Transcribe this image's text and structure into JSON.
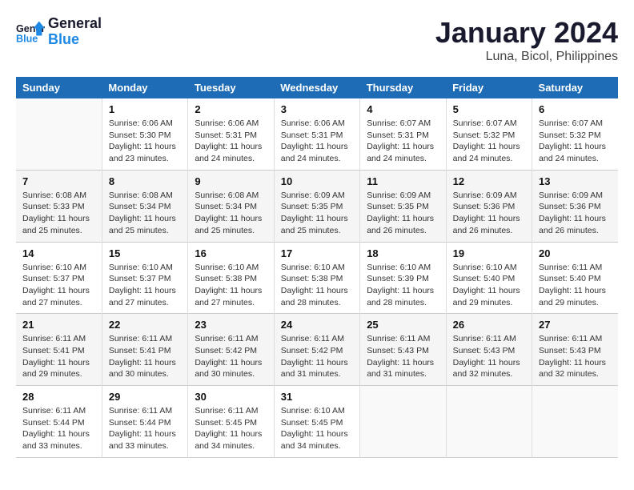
{
  "header": {
    "logo_general": "General",
    "logo_blue": "Blue",
    "title": "January 2024",
    "subtitle": "Luna, Bicol, Philippines"
  },
  "weekdays": [
    "Sunday",
    "Monday",
    "Tuesday",
    "Wednesday",
    "Thursday",
    "Friday",
    "Saturday"
  ],
  "weeks": [
    [
      {
        "day": "",
        "sunrise": "",
        "sunset": "",
        "daylight": ""
      },
      {
        "day": "1",
        "sunrise": "Sunrise: 6:06 AM",
        "sunset": "Sunset: 5:30 PM",
        "daylight": "Daylight: 11 hours and 23 minutes."
      },
      {
        "day": "2",
        "sunrise": "Sunrise: 6:06 AM",
        "sunset": "Sunset: 5:31 PM",
        "daylight": "Daylight: 11 hours and 24 minutes."
      },
      {
        "day": "3",
        "sunrise": "Sunrise: 6:06 AM",
        "sunset": "Sunset: 5:31 PM",
        "daylight": "Daylight: 11 hours and 24 minutes."
      },
      {
        "day": "4",
        "sunrise": "Sunrise: 6:07 AM",
        "sunset": "Sunset: 5:31 PM",
        "daylight": "Daylight: 11 hours and 24 minutes."
      },
      {
        "day": "5",
        "sunrise": "Sunrise: 6:07 AM",
        "sunset": "Sunset: 5:32 PM",
        "daylight": "Daylight: 11 hours and 24 minutes."
      },
      {
        "day": "6",
        "sunrise": "Sunrise: 6:07 AM",
        "sunset": "Sunset: 5:32 PM",
        "daylight": "Daylight: 11 hours and 24 minutes."
      }
    ],
    [
      {
        "day": "7",
        "sunrise": "Sunrise: 6:08 AM",
        "sunset": "Sunset: 5:33 PM",
        "daylight": "Daylight: 11 hours and 25 minutes."
      },
      {
        "day": "8",
        "sunrise": "Sunrise: 6:08 AM",
        "sunset": "Sunset: 5:34 PM",
        "daylight": "Daylight: 11 hours and 25 minutes."
      },
      {
        "day": "9",
        "sunrise": "Sunrise: 6:08 AM",
        "sunset": "Sunset: 5:34 PM",
        "daylight": "Daylight: 11 hours and 25 minutes."
      },
      {
        "day": "10",
        "sunrise": "Sunrise: 6:09 AM",
        "sunset": "Sunset: 5:35 PM",
        "daylight": "Daylight: 11 hours and 25 minutes."
      },
      {
        "day": "11",
        "sunrise": "Sunrise: 6:09 AM",
        "sunset": "Sunset: 5:35 PM",
        "daylight": "Daylight: 11 hours and 26 minutes."
      },
      {
        "day": "12",
        "sunrise": "Sunrise: 6:09 AM",
        "sunset": "Sunset: 5:36 PM",
        "daylight": "Daylight: 11 hours and 26 minutes."
      },
      {
        "day": "13",
        "sunrise": "Sunrise: 6:09 AM",
        "sunset": "Sunset: 5:36 PM",
        "daylight": "Daylight: 11 hours and 26 minutes."
      }
    ],
    [
      {
        "day": "14",
        "sunrise": "Sunrise: 6:10 AM",
        "sunset": "Sunset: 5:37 PM",
        "daylight": "Daylight: 11 hours and 27 minutes."
      },
      {
        "day": "15",
        "sunrise": "Sunrise: 6:10 AM",
        "sunset": "Sunset: 5:37 PM",
        "daylight": "Daylight: 11 hours and 27 minutes."
      },
      {
        "day": "16",
        "sunrise": "Sunrise: 6:10 AM",
        "sunset": "Sunset: 5:38 PM",
        "daylight": "Daylight: 11 hours and 27 minutes."
      },
      {
        "day": "17",
        "sunrise": "Sunrise: 6:10 AM",
        "sunset": "Sunset: 5:38 PM",
        "daylight": "Daylight: 11 hours and 28 minutes."
      },
      {
        "day": "18",
        "sunrise": "Sunrise: 6:10 AM",
        "sunset": "Sunset: 5:39 PM",
        "daylight": "Daylight: 11 hours and 28 minutes."
      },
      {
        "day": "19",
        "sunrise": "Sunrise: 6:10 AM",
        "sunset": "Sunset: 5:40 PM",
        "daylight": "Daylight: 11 hours and 29 minutes."
      },
      {
        "day": "20",
        "sunrise": "Sunrise: 6:11 AM",
        "sunset": "Sunset: 5:40 PM",
        "daylight": "Daylight: 11 hours and 29 minutes."
      }
    ],
    [
      {
        "day": "21",
        "sunrise": "Sunrise: 6:11 AM",
        "sunset": "Sunset: 5:41 PM",
        "daylight": "Daylight: 11 hours and 29 minutes."
      },
      {
        "day": "22",
        "sunrise": "Sunrise: 6:11 AM",
        "sunset": "Sunset: 5:41 PM",
        "daylight": "Daylight: 11 hours and 30 minutes."
      },
      {
        "day": "23",
        "sunrise": "Sunrise: 6:11 AM",
        "sunset": "Sunset: 5:42 PM",
        "daylight": "Daylight: 11 hours and 30 minutes."
      },
      {
        "day": "24",
        "sunrise": "Sunrise: 6:11 AM",
        "sunset": "Sunset: 5:42 PM",
        "daylight": "Daylight: 11 hours and 31 minutes."
      },
      {
        "day": "25",
        "sunrise": "Sunrise: 6:11 AM",
        "sunset": "Sunset: 5:43 PM",
        "daylight": "Daylight: 11 hours and 31 minutes."
      },
      {
        "day": "26",
        "sunrise": "Sunrise: 6:11 AM",
        "sunset": "Sunset: 5:43 PM",
        "daylight": "Daylight: 11 hours and 32 minutes."
      },
      {
        "day": "27",
        "sunrise": "Sunrise: 6:11 AM",
        "sunset": "Sunset: 5:43 PM",
        "daylight": "Daylight: 11 hours and 32 minutes."
      }
    ],
    [
      {
        "day": "28",
        "sunrise": "Sunrise: 6:11 AM",
        "sunset": "Sunset: 5:44 PM",
        "daylight": "Daylight: 11 hours and 33 minutes."
      },
      {
        "day": "29",
        "sunrise": "Sunrise: 6:11 AM",
        "sunset": "Sunset: 5:44 PM",
        "daylight": "Daylight: 11 hours and 33 minutes."
      },
      {
        "day": "30",
        "sunrise": "Sunrise: 6:11 AM",
        "sunset": "Sunset: 5:45 PM",
        "daylight": "Daylight: 11 hours and 34 minutes."
      },
      {
        "day": "31",
        "sunrise": "Sunrise: 6:10 AM",
        "sunset": "Sunset: 5:45 PM",
        "daylight": "Daylight: 11 hours and 34 minutes."
      },
      {
        "day": "",
        "sunrise": "",
        "sunset": "",
        "daylight": ""
      },
      {
        "day": "",
        "sunrise": "",
        "sunset": "",
        "daylight": ""
      },
      {
        "day": "",
        "sunrise": "",
        "sunset": "",
        "daylight": ""
      }
    ]
  ]
}
